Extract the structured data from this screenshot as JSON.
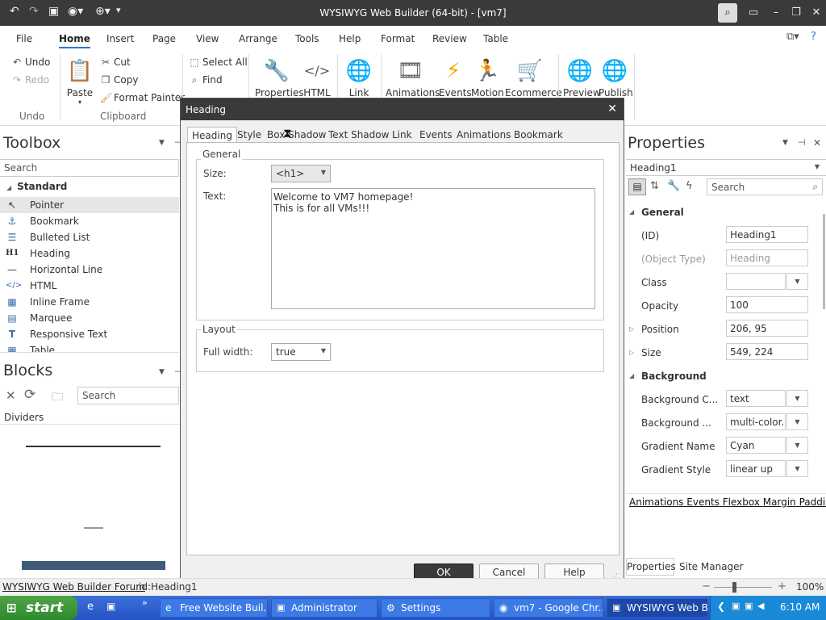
{
  "app": {
    "title": "WYSIWYG Web Builder (64-bit) - [vm7]"
  },
  "menu": [
    "File",
    "Home",
    "Insert",
    "Page",
    "View",
    "Arrange",
    "Tools",
    "Help",
    "Format",
    "Review",
    "Table"
  ],
  "ribbon": {
    "undo": "Undo",
    "redo": "Redo",
    "undo_group": "Undo",
    "paste": "Paste",
    "cut": "Cut",
    "copy": "Copy",
    "format_painter": "Format Painter",
    "clipboard_group": "Clipboard",
    "select_all": "Select All",
    "find": "Find",
    "properties": "Properties",
    "html": "HTML",
    "link": "Link",
    "animations": "Animations",
    "events": "Events",
    "motion": "Motion",
    "ecommerce": "Ecommerce",
    "preview": "Preview",
    "publish": "Publish"
  },
  "toolbox": {
    "title": "Toolbox",
    "search_placeholder": "Search",
    "category": "Standard",
    "items": [
      "Pointer",
      "Bookmark",
      "Bulleted List",
      "Heading",
      "Horizontal Line",
      "HTML",
      "Inline Frame",
      "Marquee",
      "Responsive Text",
      "Table"
    ]
  },
  "blocks": {
    "title": "Blocks",
    "search_placeholder": "Search",
    "category": "Dividers"
  },
  "dialog": {
    "title": "Heading",
    "tabs": [
      "Heading",
      "Style",
      "Box Shadow",
      "Text Shadow",
      "Link",
      "Events",
      "Animations",
      "Bookmark"
    ],
    "general_legend": "General",
    "size_label": "Size:",
    "size_value": "<h1>",
    "text_label": "Text:",
    "text_line1": "Welcome to VM7 homepage!",
    "text_line2": "This is for all VMs!!!",
    "layout_legend": "Layout",
    "fullwidth_label": "Full width:",
    "fullwidth_value": "true",
    "ok": "OK",
    "cancel": "Cancel",
    "help": "Help"
  },
  "properties": {
    "title": "Properties",
    "selected": "Heading1",
    "search_placeholder": "Search",
    "general_section": "General",
    "rows": [
      {
        "label": "(ID)",
        "value": "Heading1"
      },
      {
        "label": "(Object Type)",
        "value": "Heading"
      },
      {
        "label": "Class",
        "value": ""
      },
      {
        "label": "Opacity",
        "value": "100"
      },
      {
        "label": "Position",
        "value": "206, 95"
      },
      {
        "label": "Size",
        "value": "549, 224"
      }
    ],
    "background_section": "Background",
    "bg_rows": [
      {
        "label": "Background C...",
        "value": "text"
      },
      {
        "label": "Background ...",
        "value": "multi-color..."
      },
      {
        "label": "Gradient Name",
        "value": "Cyan"
      },
      {
        "label": "Gradient Style",
        "value": "linear up"
      }
    ],
    "links": [
      "Animations",
      "Events",
      "Flexbox",
      "Margin",
      "Padding"
    ],
    "tabs": [
      "Properties",
      "Site Manager"
    ]
  },
  "statusbar": {
    "forum": "WYSIWYG Web Builder Forum",
    "id": "id:Heading1",
    "zoom": "100%"
  },
  "taskbar": {
    "start": "start",
    "tasks": [
      "Free Website Buil...",
      "Administrator",
      "Settings",
      "vm7 - Google Chr...",
      "WYSIWYG Web B..."
    ],
    "time": "6:10 AM"
  }
}
